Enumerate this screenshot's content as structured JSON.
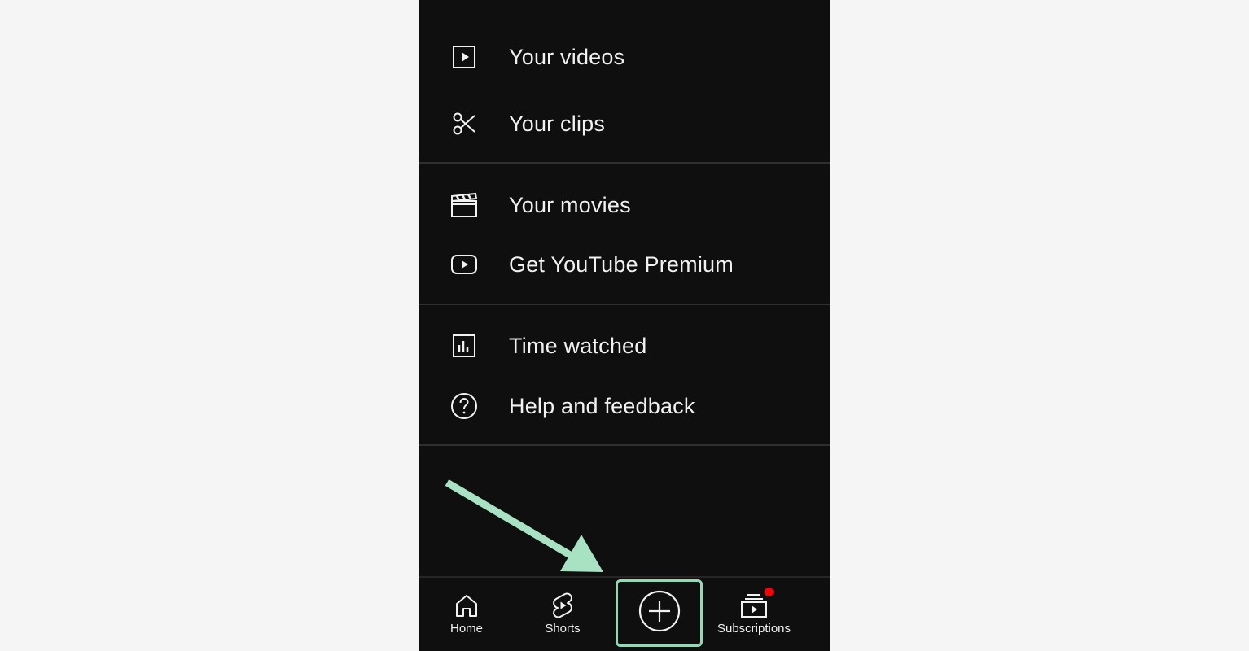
{
  "menu": {
    "items": [
      {
        "label": "Your videos",
        "icon": "play-square-icon"
      },
      {
        "label": "Your clips",
        "icon": "scissors-icon"
      },
      {
        "label": "Your movies",
        "icon": "clapperboard-icon"
      },
      {
        "label": "Get YouTube Premium",
        "icon": "youtube-logo-icon"
      },
      {
        "label": "Time watched",
        "icon": "bar-chart-icon"
      },
      {
        "label": "Help and feedback",
        "icon": "help-circle-icon"
      }
    ]
  },
  "navbar": {
    "home_label": "Home",
    "shorts_label": "Shorts",
    "create_icon": "plus-circle-icon",
    "subscriptions_label": "Subscriptions",
    "subscriptions_badge": true
  },
  "colors": {
    "page_background": "#f5f5f5",
    "app_background": "#0f0f0f",
    "text": "#f1f1f1",
    "highlight": "#8fdcb2",
    "notification_dot": "#ff0000"
  }
}
